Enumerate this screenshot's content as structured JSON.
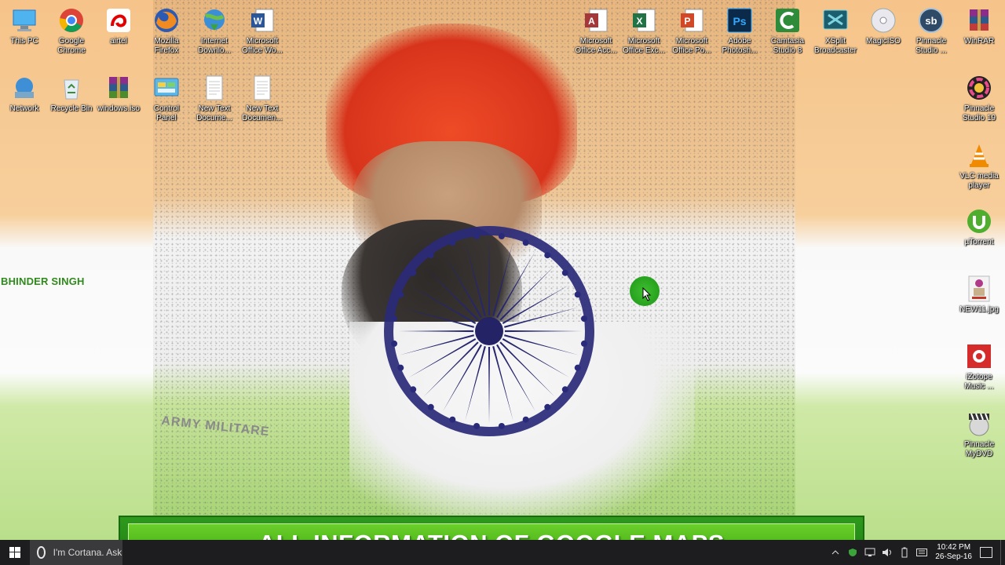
{
  "wallpaper": {
    "name_text": "BHINDER SINGH",
    "shirt_text": "ARMY MILITARE"
  },
  "desktop_icons": [
    {
      "id": "this-pc",
      "label": "This PC",
      "icon": "computer-icon"
    },
    {
      "id": "google-chrome",
      "label": "Google\nChrome",
      "icon": "chrome-icon"
    },
    {
      "id": "airtel",
      "label": "airtel",
      "icon": "airtel-icon"
    },
    {
      "id": "mozilla-firefox",
      "label": "Mozilla\nFirefox",
      "icon": "firefox-icon"
    },
    {
      "id": "internet-download",
      "label": "Internet\nDownlo...",
      "icon": "globe-download-icon"
    },
    {
      "id": "ms-word",
      "label": "Microsoft\nOffice Wo...",
      "icon": "word-icon"
    },
    {
      "id": "network",
      "label": "Network",
      "icon": "network-icon"
    },
    {
      "id": "recycle-bin",
      "label": "Recycle Bin",
      "icon": "recycle-bin-icon"
    },
    {
      "id": "windows-iso",
      "label": "windows.iso",
      "icon": "winrar-archive-icon"
    },
    {
      "id": "control-panel",
      "label": "Control\nPanel",
      "icon": "control-panel-icon"
    },
    {
      "id": "new-text-1",
      "label": "New Text\nDocume...",
      "icon": "text-document-icon"
    },
    {
      "id": "new-text-2",
      "label": "New Text\nDocumen...",
      "icon": "text-document-icon"
    },
    {
      "id": "ms-access",
      "label": "Microsoft\nOffice Acc...",
      "icon": "access-icon"
    },
    {
      "id": "ms-excel",
      "label": "Microsoft\nOffice Exc...",
      "icon": "excel-icon"
    },
    {
      "id": "ms-powerpoint",
      "label": "Microsoft\nOffice Po...",
      "icon": "powerpoint-icon"
    },
    {
      "id": "photoshop",
      "label": "Adobe\nPhotosh...",
      "icon": "photoshop-icon"
    },
    {
      "id": "camtasia",
      "label": "Camtasia\nStudio 8",
      "icon": "camtasia-icon"
    },
    {
      "id": "xsplit",
      "label": "XSplit\nBroadcaster",
      "icon": "xsplit-icon"
    },
    {
      "id": "magiciso",
      "label": "MagicISO",
      "icon": "disc-icon"
    },
    {
      "id": "pinnacle-studio",
      "label": "Pinnacle\nStudio ...",
      "icon": "pinnacle-sb-icon"
    },
    {
      "id": "winrar",
      "label": "WinRAR",
      "icon": "winrar-icon"
    },
    {
      "id": "pinnacle-19",
      "label": "Pinnacle\nStudio 19",
      "icon": "pinnacle-color-icon"
    },
    {
      "id": "vlc",
      "label": "VLC media\nplayer",
      "icon": "vlc-cone-icon"
    },
    {
      "id": "utorrent",
      "label": "µTorrent",
      "icon": "utorrent-icon"
    },
    {
      "id": "new-jpg",
      "label": "NEW11.jpg",
      "icon": "image-thumbnail-icon"
    },
    {
      "id": "izotope",
      "label": "iZotope\nMusic ...",
      "icon": "izotope-icon"
    },
    {
      "id": "pinnacle-mydvd",
      "label": "Pinnacle\nMyDVD",
      "icon": "dvd-clapper-icon"
    }
  ],
  "banner": {
    "text": "ALL INFORMATION OF GOOGLE MAPS"
  },
  "taskbar": {
    "cortana_text": "I'm Cortana. Ask me anything.",
    "clock_time": "10:42 PM",
    "clock_date": "26-Sep-16"
  }
}
